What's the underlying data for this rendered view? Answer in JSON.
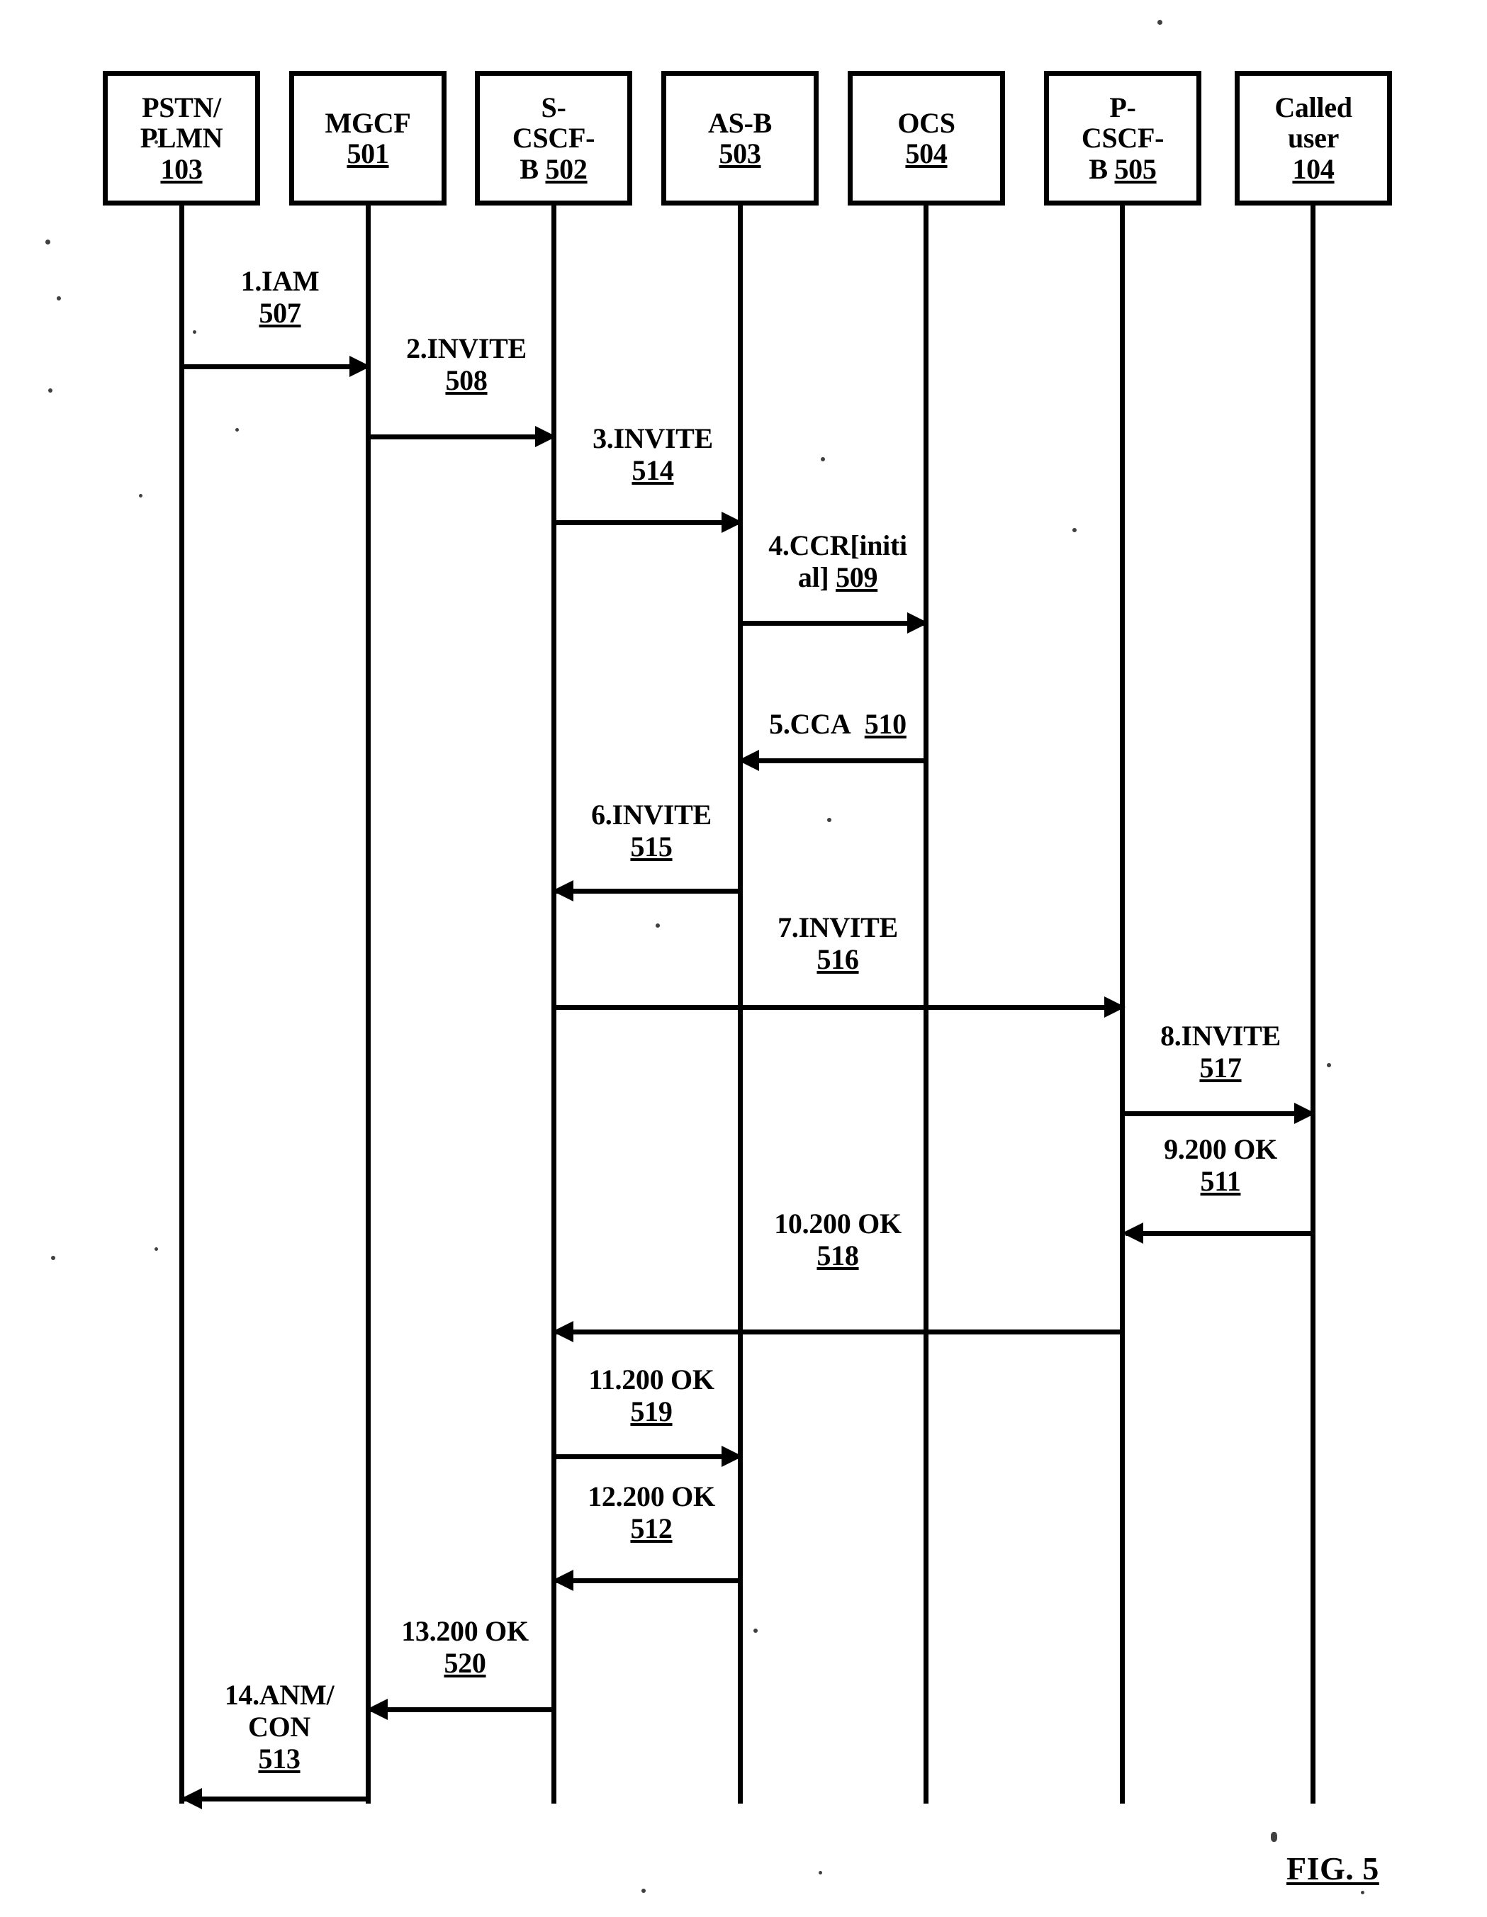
{
  "figure": {
    "caption": "FIG. 5"
  },
  "actors": [
    {
      "id": "pstn",
      "lines": [
        "PSTN/",
        "PLMN"
      ],
      "ref": "103",
      "ref_inline": false
    },
    {
      "id": "mgcf",
      "lines": [
        "MGCF"
      ],
      "ref": "501",
      "ref_inline": false
    },
    {
      "id": "scscfb",
      "lines": [
        "S-",
        "CSCF-"
      ],
      "ref": "502",
      "ref_inline": true,
      "ref_prefix": "B "
    },
    {
      "id": "asb",
      "lines": [
        "AS-B"
      ],
      "ref": "503",
      "ref_inline": false
    },
    {
      "id": "ocs",
      "lines": [
        "OCS"
      ],
      "ref": "504",
      "ref_inline": false
    },
    {
      "id": "pcscfb",
      "lines": [
        "P-",
        "CSCF-"
      ],
      "ref": "505",
      "ref_inline": true,
      "ref_prefix": "B "
    },
    {
      "id": "called",
      "lines": [
        "Called",
        "user"
      ],
      "ref": "104",
      "ref_inline": false
    }
  ],
  "messages": [
    {
      "n": 1,
      "label": "1.IAM",
      "label2": "",
      "ref": "507",
      "from": "pstn",
      "to": "mgcf",
      "dir": "right"
    },
    {
      "n": 2,
      "label": "2.INVITE",
      "label2": "",
      "ref": "508",
      "from": "mgcf",
      "to": "scscfb",
      "dir": "right"
    },
    {
      "n": 3,
      "label": "3.INVITE",
      "label2": "",
      "ref": "514",
      "from": "scscfb",
      "to": "asb",
      "dir": "right"
    },
    {
      "n": 4,
      "label": "4.CCR[initi",
      "label2": "al]",
      "ref": "509",
      "from": "asb",
      "to": "ocs",
      "dir": "right"
    },
    {
      "n": 5,
      "label": "5.CCA",
      "label2": "",
      "ref": "510",
      "from": "ocs",
      "to": "asb",
      "dir": "left",
      "inline_ref": true
    },
    {
      "n": 6,
      "label": "6.INVITE",
      "label2": "",
      "ref": "515",
      "from": "asb",
      "to": "scscfb",
      "dir": "left"
    },
    {
      "n": 7,
      "label": "7.INVITE",
      "label2": "",
      "ref": "516",
      "from": "scscfb",
      "to": "pcscfb",
      "dir": "right"
    },
    {
      "n": 8,
      "label": "8.INVITE",
      "label2": "",
      "ref": "517",
      "from": "pcscfb",
      "to": "called",
      "dir": "right"
    },
    {
      "n": 9,
      "label": "9.200 OK",
      "label2": "",
      "ref": "511",
      "from": "called",
      "to": "pcscfb",
      "dir": "left"
    },
    {
      "n": 10,
      "label": "10.200 OK",
      "label2": "",
      "ref": "518",
      "from": "pcscfb",
      "to": "scscfb",
      "dir": "left"
    },
    {
      "n": 11,
      "label": "11.200 OK",
      "label2": "",
      "ref": "519",
      "from": "scscfb",
      "to": "asb",
      "dir": "right"
    },
    {
      "n": 12,
      "label": "12.200 OK",
      "label2": "",
      "ref": "512",
      "from": "asb",
      "to": "scscfb",
      "dir": "left"
    },
    {
      "n": 13,
      "label": "13.200 OK",
      "label2": "",
      "ref": "520",
      "from": "scscfb",
      "to": "mgcf",
      "dir": "left"
    },
    {
      "n": 14,
      "label": "14.ANM/",
      "label2": "CON",
      "ref": "513",
      "from": "mgcf",
      "to": "pstn",
      "dir": "left"
    }
  ]
}
